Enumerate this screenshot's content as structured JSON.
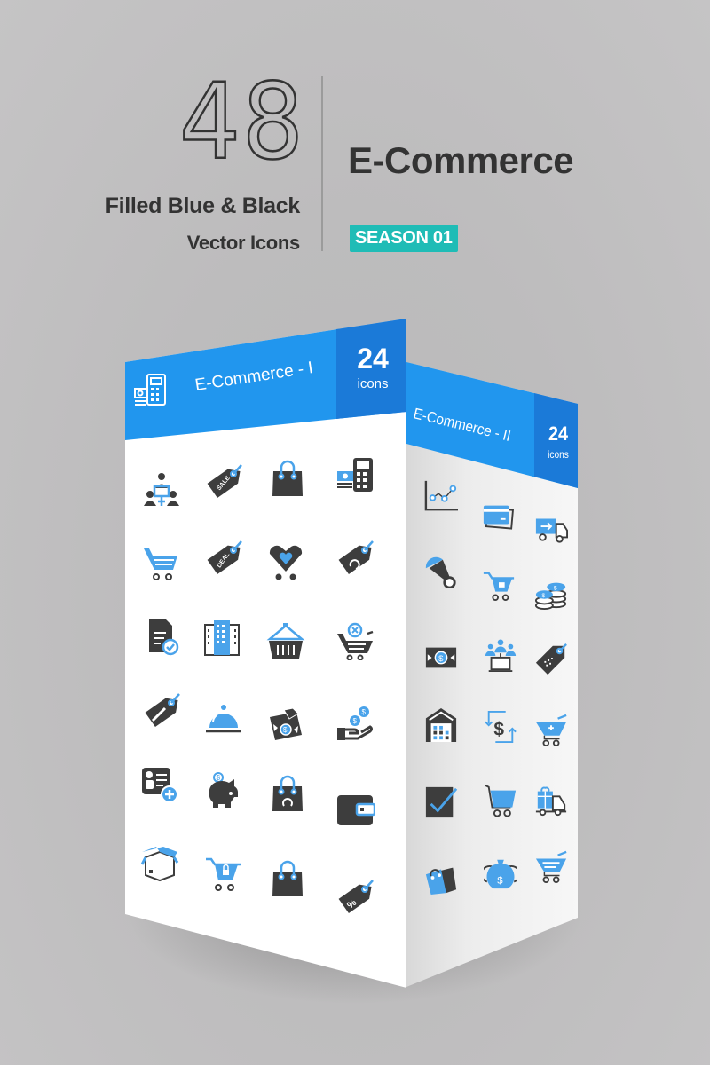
{
  "header": {
    "count": "48",
    "subtitle_line1": "Filled Blue & Black",
    "subtitle_line2": "Vector Icons",
    "title": "E-Commerce",
    "badge": "SEASON 01"
  },
  "colors": {
    "blue": "#2196ee",
    "blue_dark": "#1b7ad8",
    "icon_blue": "#4aa3ea",
    "icon_black": "#3d3d3d",
    "teal_badge": "#1fbcb6",
    "background": "#bdbcbd"
  },
  "panels": [
    {
      "label": "E-Commerce - I",
      "count": "24",
      "count_unit": "icons",
      "header_icon": "calculator-money-icon",
      "icons": [
        "team-network-icon",
        "sale-tag-icon",
        "shopping-bag-icon",
        "calculator-money-icon",
        "shopping-cart-icon",
        "deal-tag-icon",
        "heart-cart-icon",
        "refresh-tag-icon",
        "document-check-icon",
        "building-icon",
        "basket-icon",
        "cart-cancel-icon",
        "discount-tag-icon",
        "food-cloche-icon",
        "payment-envelope-icon",
        "hand-coins-icon",
        "contact-card-add-icon",
        "piggy-bank-icon",
        "bag-refresh-icon",
        "wallet-icon",
        "open-box-icon",
        "cart-lock-icon",
        "shopping-bag-icon",
        "percent-tag-icon"
      ]
    },
    {
      "label": "E-Commerce - II",
      "count": "24",
      "count_unit": "icons",
      "icons": [
        "line-chart-icon",
        "credit-card-icon",
        "delivery-truck-icon",
        "rattle-icon",
        "cart-lock-icon",
        "coin-stack-icon",
        "money-bill-icon",
        "audience-screen-icon",
        "qr-tag-icon",
        "warehouse-icon",
        "dollar-exchange-icon",
        "cart-add-icon",
        "checkbox-icon",
        "cart-icon",
        "gift-truck-icon",
        "shopping-bags-icon",
        "money-bag-icon",
        "shopping-cart-icon"
      ]
    }
  ]
}
